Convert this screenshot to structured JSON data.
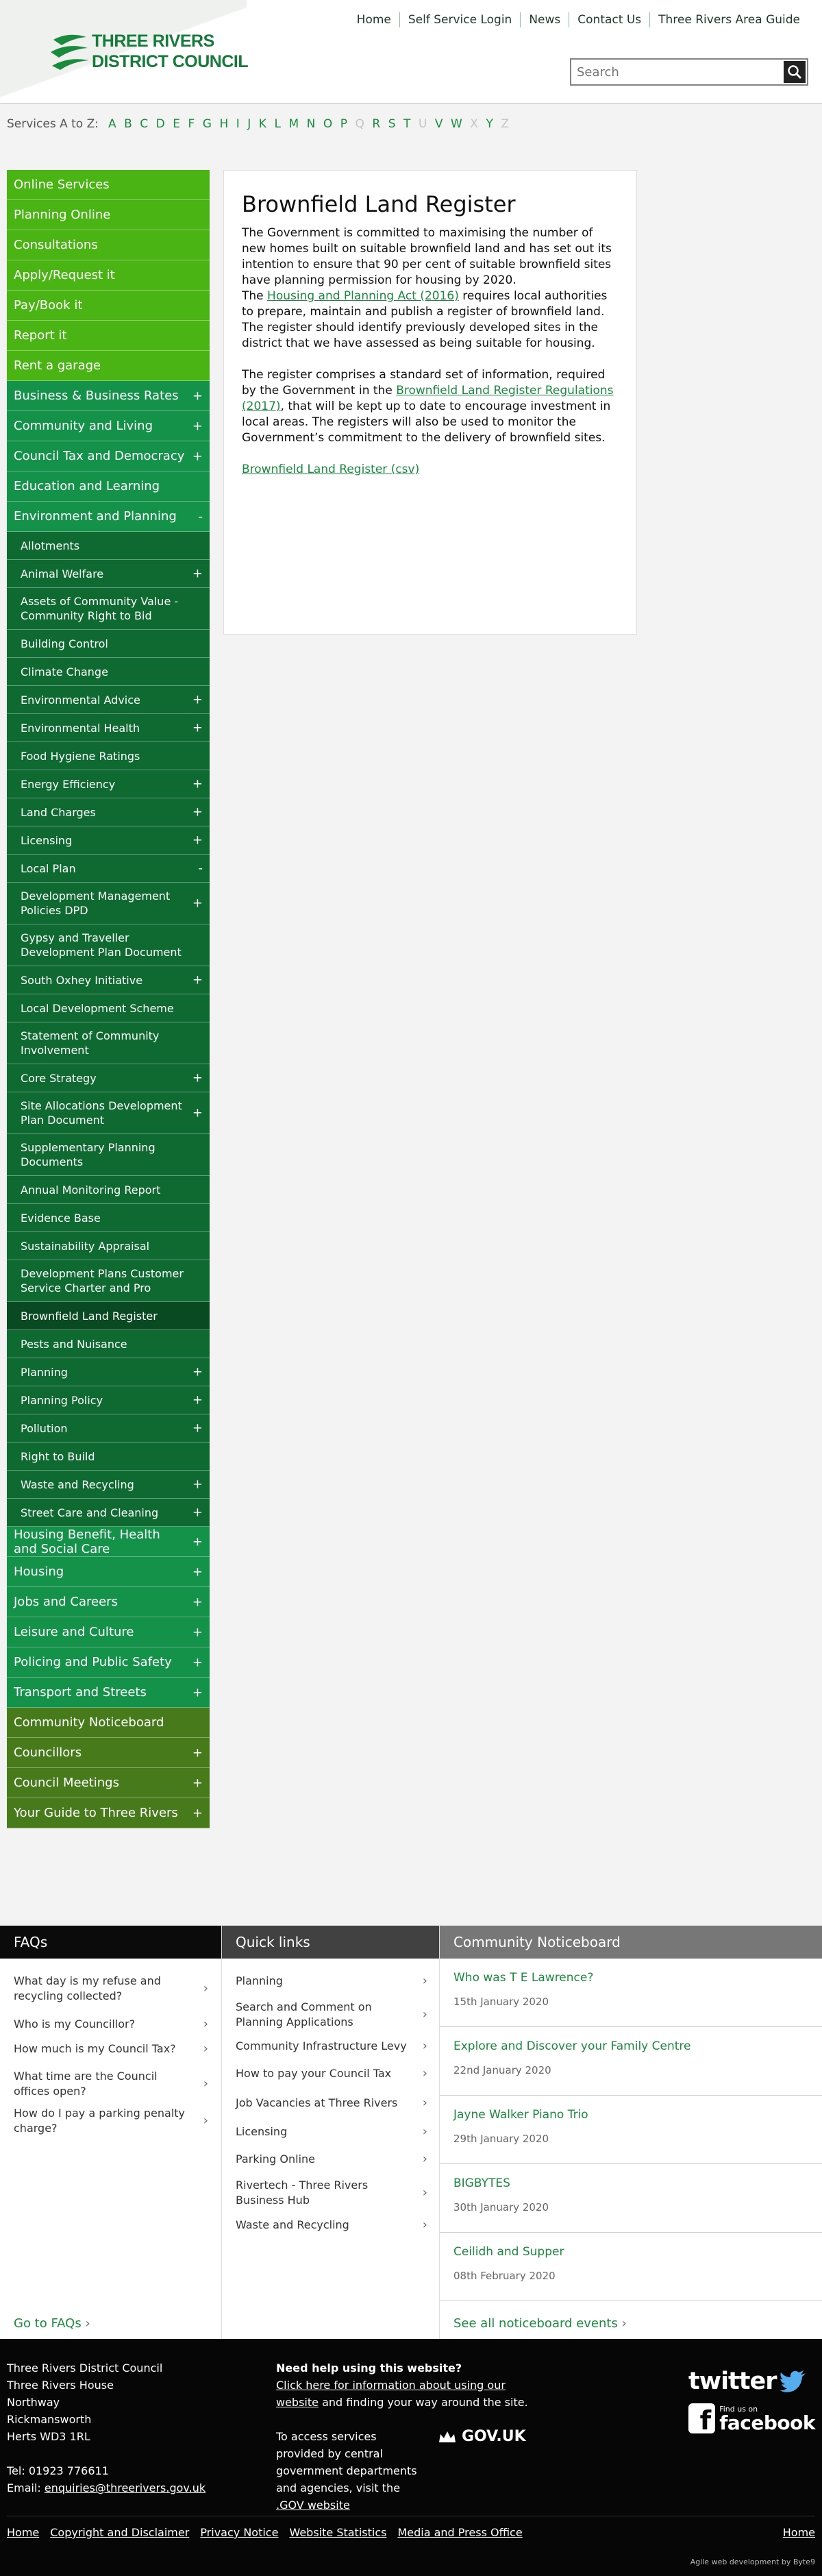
{
  "header": {
    "logo_line1": "THREE RIVERS",
    "logo_line2": "DISTRICT COUNCIL",
    "nav": [
      "Home",
      "Self Service Login",
      "News",
      "Contact Us",
      "Three Rivers Area Guide"
    ],
    "search_placeholder": "Search"
  },
  "az": {
    "label": "Services A to Z:",
    "letters": [
      {
        "l": "A",
        "on": true
      },
      {
        "l": "B",
        "on": true
      },
      {
        "l": "C",
        "on": true
      },
      {
        "l": "D",
        "on": true
      },
      {
        "l": "E",
        "on": true
      },
      {
        "l": "F",
        "on": true
      },
      {
        "l": "G",
        "on": true
      },
      {
        "l": "H",
        "on": true
      },
      {
        "l": "I",
        "on": true
      },
      {
        "l": "J",
        "on": true
      },
      {
        "l": "K",
        "on": true
      },
      {
        "l": "L",
        "on": true
      },
      {
        "l": "M",
        "on": true
      },
      {
        "l": "N",
        "on": true
      },
      {
        "l": "O",
        "on": true
      },
      {
        "l": "P",
        "on": true
      },
      {
        "l": "Q",
        "on": false
      },
      {
        "l": "R",
        "on": true
      },
      {
        "l": "S",
        "on": true
      },
      {
        "l": "T",
        "on": true
      },
      {
        "l": "U",
        "on": false
      },
      {
        "l": "V",
        "on": true
      },
      {
        "l": "W",
        "on": true
      },
      {
        "l": "X",
        "on": false
      },
      {
        "l": "Y",
        "on": true
      },
      {
        "l": "Z",
        "on": false
      }
    ]
  },
  "sidenav": [
    {
      "label": "Online Services",
      "style": "g1",
      "sign": ""
    },
    {
      "label": "Planning Online",
      "style": "g1",
      "sign": ""
    },
    {
      "label": "Consultations",
      "style": "g1",
      "sign": ""
    },
    {
      "label": "Apply/Request it",
      "style": "g1",
      "sign": ""
    },
    {
      "label": "Pay/Book it",
      "style": "g1",
      "sign": ""
    },
    {
      "label": "Report it",
      "style": "g1",
      "sign": ""
    },
    {
      "label": "Rent a garage",
      "style": "g1",
      "sign": ""
    },
    {
      "label": "Business & Business Rates",
      "style": "g2",
      "sign": "+"
    },
    {
      "label": "Community and Living",
      "style": "g2",
      "sign": "+"
    },
    {
      "label": "Council Tax and Democracy",
      "style": "g2",
      "sign": "+"
    },
    {
      "label": "Education and Learning",
      "style": "g2",
      "sign": ""
    },
    {
      "label": "Environment and Planning",
      "style": "g2",
      "sign": "-"
    },
    {
      "label": "Allotments",
      "style": "g3",
      "sign": ""
    },
    {
      "label": "Animal Welfare",
      "style": "g3",
      "sign": "+"
    },
    {
      "label": "Assets of Community Value - Community Right to Bid",
      "style": "g3",
      "sign": ""
    },
    {
      "label": "Building Control",
      "style": "g3",
      "sign": ""
    },
    {
      "label": "Climate Change",
      "style": "g3",
      "sign": ""
    },
    {
      "label": "Environmental Advice",
      "style": "g3",
      "sign": "+"
    },
    {
      "label": "Environmental Health",
      "style": "g3",
      "sign": "+"
    },
    {
      "label": "Food Hygiene Ratings",
      "style": "g3",
      "sign": ""
    },
    {
      "label": "Energy Efficiency",
      "style": "g3",
      "sign": "+"
    },
    {
      "label": "Land Charges",
      "style": "g3",
      "sign": "+"
    },
    {
      "label": "Licensing",
      "style": "g3",
      "sign": "+"
    },
    {
      "label": "Local Plan",
      "style": "g3",
      "sign": "-"
    },
    {
      "label": "Development Management Policies DPD",
      "style": "g3",
      "sign": "+"
    },
    {
      "label": "Gypsy and Traveller Development Plan Document",
      "style": "g3",
      "sign": ""
    },
    {
      "label": "South Oxhey Initiative",
      "style": "g3",
      "sign": "+"
    },
    {
      "label": "Local Development Scheme",
      "style": "g3",
      "sign": ""
    },
    {
      "label": "Statement of Community Involvement",
      "style": "g3",
      "sign": ""
    },
    {
      "label": "Core Strategy",
      "style": "g3",
      "sign": "+"
    },
    {
      "label": "Site Allocations Development Plan Document",
      "style": "g3",
      "sign": "+"
    },
    {
      "label": "Supplementary Planning Documents",
      "style": "g3",
      "sign": ""
    },
    {
      "label": "Annual Monitoring Report",
      "style": "g3",
      "sign": ""
    },
    {
      "label": "Evidence Base",
      "style": "g3",
      "sign": ""
    },
    {
      "label": "Sustainability Appraisal",
      "style": "g3",
      "sign": ""
    },
    {
      "label": "Development Plans Customer Service Charter and Pro",
      "style": "g3",
      "sign": ""
    },
    {
      "label": "Brownfield Land Register",
      "style": "g3 sel",
      "sign": ""
    },
    {
      "label": "Pests and Nuisance",
      "style": "g3",
      "sign": ""
    },
    {
      "label": "Planning",
      "style": "g3",
      "sign": "+"
    },
    {
      "label": "Planning Policy",
      "style": "g3",
      "sign": "+"
    },
    {
      "label": "Pollution",
      "style": "g3",
      "sign": "+"
    },
    {
      "label": "Right to Build",
      "style": "g3",
      "sign": ""
    },
    {
      "label": "Waste and Recycling",
      "style": "g3",
      "sign": "+"
    },
    {
      "label": "Street Care and Cleaning",
      "style": "g3",
      "sign": "+"
    },
    {
      "label": "Housing Benefit, Health and Social Care",
      "style": "g2",
      "sign": "+"
    },
    {
      "label": "Housing",
      "style": "g2",
      "sign": "+"
    },
    {
      "label": "Jobs and Careers",
      "style": "g2",
      "sign": "+"
    },
    {
      "label": "Leisure and Culture",
      "style": "g2",
      "sign": "+"
    },
    {
      "label": "Policing and Public Safety",
      "style": "g2",
      "sign": "+"
    },
    {
      "label": "Transport and Streets",
      "style": "g2",
      "sign": "+"
    },
    {
      "label": "Community Noticeboard",
      "style": "g4",
      "sign": ""
    },
    {
      "label": "Councillors",
      "style": "g4",
      "sign": "+"
    },
    {
      "label": "Council Meetings",
      "style": "g4",
      "sign": "+"
    },
    {
      "label": "Your Guide to Three Rivers",
      "style": "g4",
      "sign": "+"
    }
  ],
  "main": {
    "title": "Brownfield Land Register",
    "p1": "The Government is committed to maximising the number of new homes built on suitable brownfield land and has set out its intention to ensure that 90 per cent of suitable brownfield sites have planning permission for housing by 2020.",
    "p2_pre": "The ",
    "p2_link": "Housing and Planning Act (2016)",
    "p2_post": " requires local authorities to prepare, maintain and publish a register of brownfield land. The register should identify previously developed sites in the district that we have assessed as being suitable for housing.",
    "p3_pre": "The register comprises a standard set of information, required by the Government in the ",
    "p3_link": "Brownfield Land Register Regulations (2017)",
    "p3_post": ", that will be kept up to date to encourage investment in local areas. The registers will also be used to monitor the Government’s commitment to the delivery of brownfield sites.",
    "csv_link": "Brownfield Land Register (csv)"
  },
  "faqs": {
    "heading": "FAQs",
    "items": [
      "What day is my refuse and recycling collected?",
      "Who is my Councillor?",
      "How much is my Council Tax?",
      "What time are the Council offices open?",
      "How do I pay a parking penalty charge?"
    ],
    "link": "Go to FAQs"
  },
  "quicklinks": {
    "heading": "Quick links",
    "items": [
      "Planning",
      "Search and Comment on Planning Applications",
      "Community Infrastructure Levy",
      "How to pay your Council Tax",
      "Job Vacancies at Three Rivers",
      "Licensing",
      "Parking Online",
      "Rivertech - Three Rivers Business Hub",
      "Waste and Recycling"
    ]
  },
  "noticeboard": {
    "heading": "Community Noticeboard",
    "events": [
      {
        "title": "Who was T E Lawrence?",
        "date": "15th January 2020"
      },
      {
        "title": "Explore and Discover your Family Centre",
        "date": "22nd January 2020"
      },
      {
        "title": "Jayne Walker Piano Trio",
        "date": "29th January 2020"
      },
      {
        "title": "BIGBYTES",
        "date": "30th January 2020"
      },
      {
        "title": "Ceilidh and Supper",
        "date": "08th February 2020"
      }
    ],
    "link": "See all noticeboard events"
  },
  "footer": {
    "address": [
      "Three Rivers District Council",
      "Three Rivers House",
      "Northway",
      "Rickmansworth",
      "Herts WD3 1RL"
    ],
    "tel": "Tel: 01923 776611",
    "email_label": "Email: ",
    "email": "enquiries@threerivers.gov.uk",
    "help_heading": "Need help using this website?",
    "help_link": "Click here for information about using our website",
    "help_post": " and finding your way around the site.",
    "gov_pre": "To access services provided by central government departments and agencies, visit the",
    "gov_link": " .GOV website",
    "gov_logo": "GOV.UK",
    "twitter": "twitter",
    "facebook_small": "Find us on",
    "facebook": "facebook",
    "links": [
      "Home",
      "Copyright and Disclaimer",
      "Privacy Notice",
      "Website Statistics",
      "Media and Press Office"
    ],
    "home": "Home",
    "agile": "Agile web development by Byte9"
  }
}
